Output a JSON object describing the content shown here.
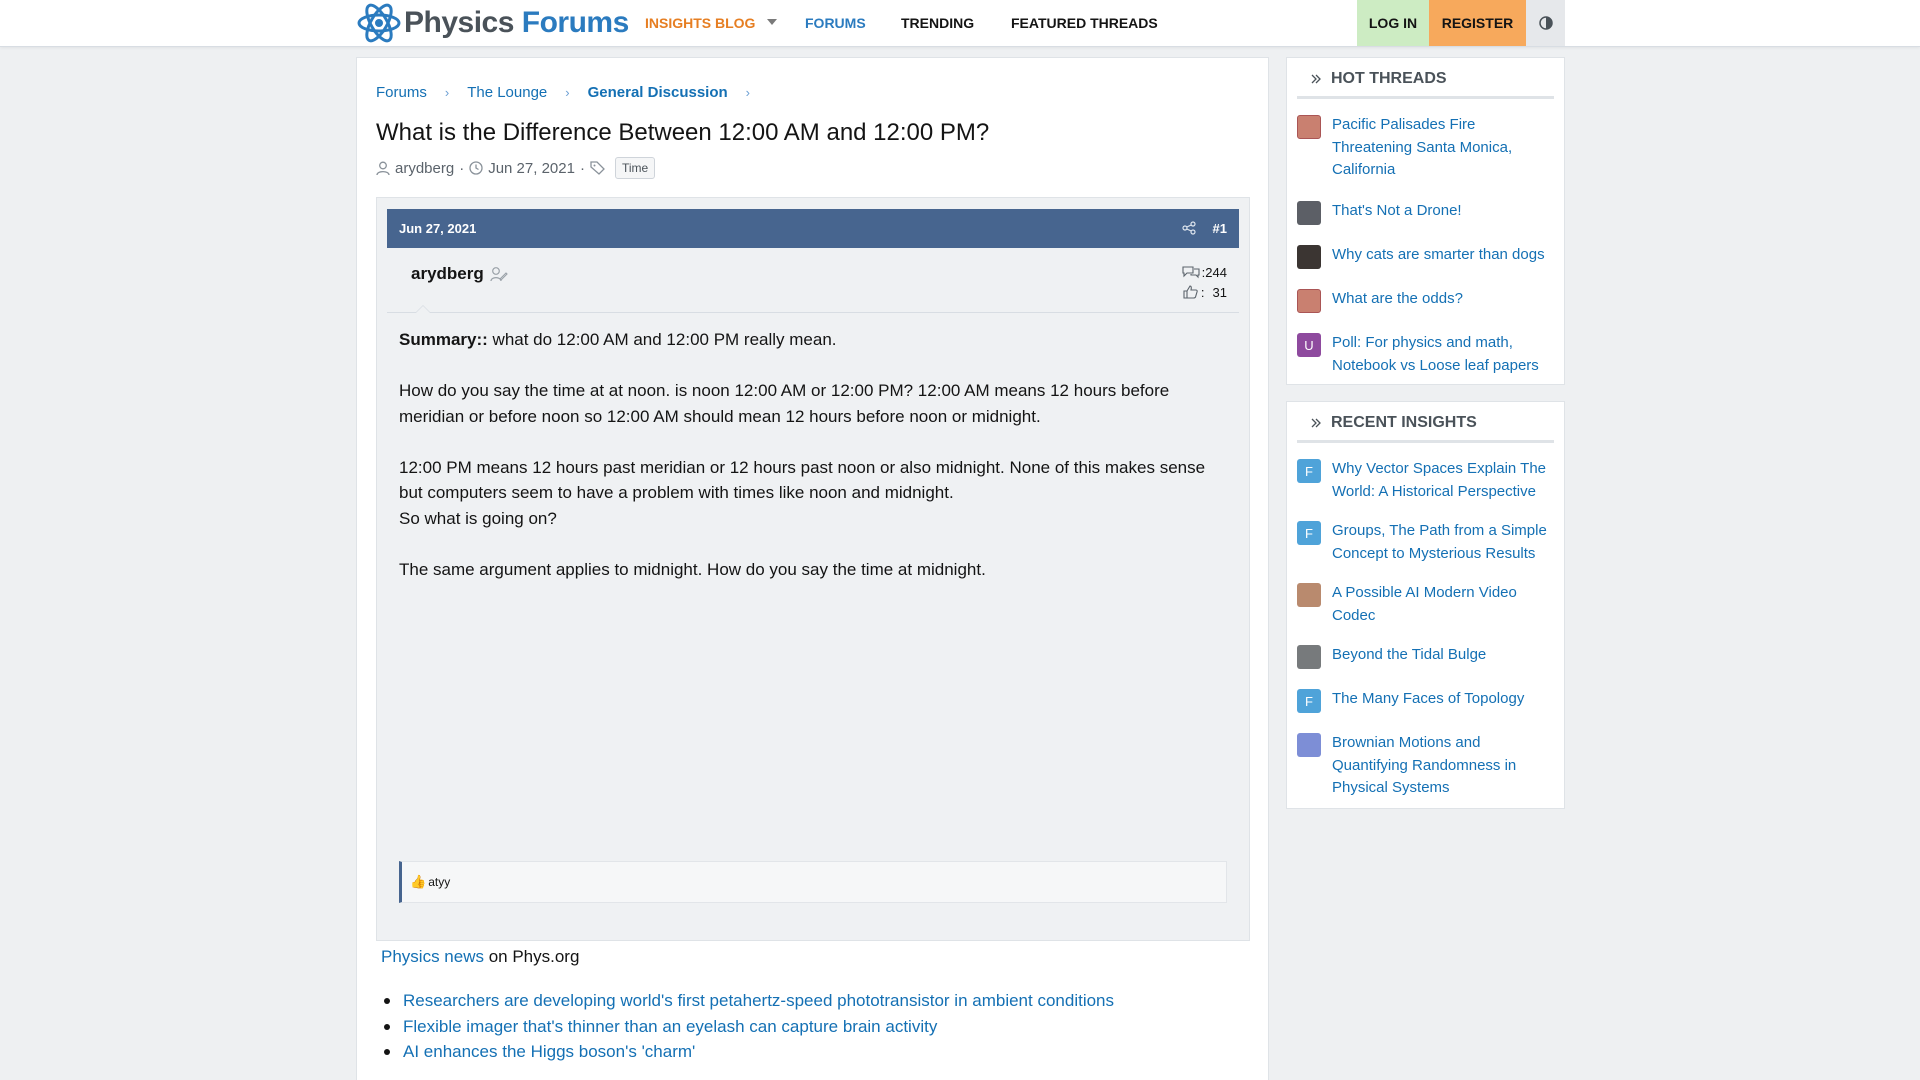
{
  "header": {
    "logo_word1": "Physics",
    "logo_word2": "Forums",
    "nav": {
      "insights": "INSIGHTS BLOG",
      "forums": "FORUMS",
      "trending": "TRENDING",
      "featured": "FEATURED THREADS"
    },
    "login": "LOG IN",
    "register": "REGISTER"
  },
  "breadcrumb": [
    "Forums",
    "The Lounge",
    "General Discussion"
  ],
  "thread": {
    "title": "What is the Difference Between 12:00 AM and 12:00 PM?",
    "author": "arydberg",
    "date": "Jun 27, 2021",
    "tag": "Time"
  },
  "post": {
    "date": "Jun 27, 2021",
    "number": "#1",
    "author": "arydberg",
    "messages": "244",
    "likes": "31",
    "summary_label": "Summary::",
    "summary_text": " what do 12:00 AM and 12:00 PM really mean.",
    "p1": "How do you say the time at at noon. is noon 12:00 AM or 12:00 PM? 12:00 AM means 12 hours before meridian or before noon so 12:00 AM should mean 12 hours before noon or midnight.",
    "p2": "12:00 PM means 12 hours past meridian or 12 hours past noon or also midnight. None of this makes sense but computers seem to have a problem with times like noon and midnight.",
    "p3": "So what is going on?",
    "p4": "The same argument applies to midnight. How do you say the time at midnight.",
    "reaction_user": "atyy"
  },
  "news": {
    "link": "Physics news",
    "suffix": " on Phys.org",
    "items": [
      "Researchers are developing world's first petahertz-speed phototransistor in ambient conditions",
      "Flexible imager that's thinner than an eyelash can capture brain activity",
      "AI enhances the Higgs boson's 'charm'"
    ]
  },
  "hot_threads": {
    "title": "HOT THREADS",
    "items": [
      "Pacific Palisades Fire Threatening Santa Monica, California",
      "That's Not a Drone!",
      "Why cats are smarter than dogs",
      "What are the odds?",
      "Poll: For physics and math, Notebook vs Loose leaf papers"
    ],
    "avatar_letter_5": "U"
  },
  "recent_insights": {
    "title": "RECENT INSIGHTS",
    "items": [
      "Why Vector Spaces Explain The World: A Historical Perspective",
      "Groups, The Path from a Simple Concept to Mysterious Results",
      "A Possible AI Modern Video Codec",
      "Beyond the Tidal Bulge",
      "The Many Faces of Topology",
      "Brownian Motions and Quantifying Randomness in Physical Systems"
    ],
    "avatar_letter": "F"
  },
  "colors": {
    "accent_blue": "#2b7bbf",
    "post_header": "#47658f",
    "insights_orange": "#e67e22",
    "login_bg": "#cdecc3",
    "register_bg": "#f7a95c"
  }
}
